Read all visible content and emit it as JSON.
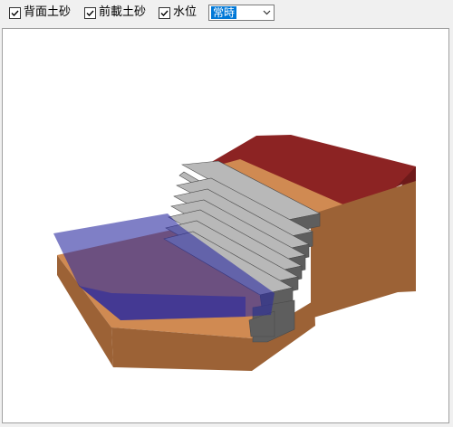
{
  "toolbar": {
    "checkboxes": [
      {
        "label": "背面土砂",
        "checked": true
      },
      {
        "label": "前載土砂",
        "checked": true
      },
      {
        "label": "水位",
        "checked": true
      }
    ],
    "water_level_select": {
      "value": "常時"
    }
  },
  "viewport": {
    "colors": {
      "backfill_top": "#8c2323",
      "backfill_side": "#6e1a1a",
      "soil_top": "#d08a52",
      "soil_side": "#9c6236",
      "wall_top": "#b8b8b8",
      "wall_face": "#5e5e5e",
      "water": "#2a2aa0"
    }
  }
}
